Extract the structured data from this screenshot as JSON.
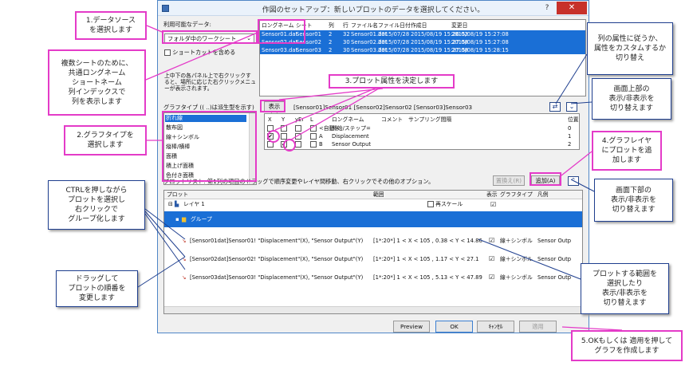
{
  "dialog": {
    "title": "作図のセットアップ：新しいプロットのデータを選択してください。",
    "help": "?",
    "close": "✕"
  },
  "left_panel": {
    "available_data_label": "利用可能なデータ:",
    "available_data_value": "フォルダ中のワークシート",
    "shortcut_label": "ショートカットを含める",
    "hint_text": "上中下の各パネル上で右クリックすると、場所に応じた右クリックメニューが表示されます。"
  },
  "top_grid": {
    "headers": [
      "ロングネーム",
      "シート",
      "列",
      "行",
      "ファイル名",
      "ファイル日付",
      "作成日",
      "変更日"
    ],
    "rows": [
      [
        "Sensor01.dat",
        "Sensor01",
        "2",
        "32",
        "Sensor01.dat",
        "2015/07/28",
        "2015/08/19 15:26:02",
        "2015/08/19 15:27:08"
      ],
      [
        "Sensor02.dat",
        "Sensor02",
        "2",
        "30",
        "Sensor02.dat",
        "2015/07/28",
        "2015/08/19 15:27:08",
        "2015/08/19 15:27:08"
      ],
      [
        "Sensor03.dat",
        "Sensor03",
        "2",
        "30",
        "Sensor03.dat",
        "2015/07/28",
        "2015/08/19 15:27:08",
        "2015/08/19 15:28:15"
      ]
    ]
  },
  "middle": {
    "graph_type_label": "グラフタイプ (( ..)は派生型を示す)",
    "show_button": "表示(S)",
    "selected_sheets": "[Sensor01]Sensor01 [Sensor02]Sensor02 [Sensor03]Sensor03",
    "graph_types": [
      "折れ線",
      "散布図",
      "線＋シンボル",
      "縦棒/横棒",
      "面積",
      "積上げ面積",
      "色付き面積"
    ],
    "col_headers": [
      "X",
      "Y",
      "yEr",
      "L",
      "ロングネーム",
      "コメント",
      "サンプリング間隔",
      "位置"
    ],
    "col_rows": [
      [
        "",
        "<自動>",
        "開始/ステップ=",
        "0"
      ],
      [
        "",
        "A",
        "Displacement",
        "1"
      ],
      [
        "",
        "B",
        "Sensor Output",
        "2"
      ]
    ]
  },
  "plot_list": {
    "title": "プロットリスト: 第1列の項目のドラッグで順序変更やレイヤ間移動、右クリックでその他のオプション。",
    "replace_button": "置換え(R)",
    "add_button": "追加(A)",
    "headers": [
      "プロット",
      "範囲",
      "表示",
      "グラフタイプ",
      "凡例"
    ],
    "layer_label": "レイヤ 1",
    "rescale_label": "再スケール",
    "group_label": "グループ",
    "rows": [
      {
        "plot": "[Sensor01dat]Sensor01! \"Displacement\"(X), \"Sensor Output\"(Y)",
        "range": "[1*:20*]  1 < X < 105 , 0.38 < Y < 14.86",
        "type": "線＋シンボル",
        "legend": "Sensor Outp"
      },
      {
        "plot": "[Sensor02dat]Sensor02! \"Displacement\"(X), \"Sensor Output\"(Y)",
        "range": "[1*:20*]  1 < X < 105 , 1.17 < Y < 27.1",
        "type": "線＋シンボル",
        "legend": "Sensor Outp"
      },
      {
        "plot": "[Sensor03dat]Sensor03! \"Displacement\"(X), \"Sensor Output\"(Y)",
        "range": "[1*:20*]  1 < X < 105 , 5.13 < Y < 47.89",
        "type": "線＋シンボル",
        "legend": "Sensor Outp"
      }
    ]
  },
  "footer": {
    "preview": "Preview",
    "ok": "OK",
    "cancel": "ｷｬﾝｾﾙ",
    "apply": "適用"
  },
  "callouts": {
    "c1": "1.データソース\nを選択します",
    "c_multi": "複数シートのために、\n共通ロングネーム\nショートネーム\n列インデックスで\n列を表示します",
    "c2": "2.グラフタイプを\n選択します",
    "c3": "3.プロット属性を決定します",
    "c_ctrl": "CTRLを押しながら\nプロットを選択し\n右クリックで\nグループ化します",
    "c_drag": "ドラッグして\nプロットの順番を\n変更します",
    "c_col_attr": "列の属性に従うか、\n属性をカスタムするか\n切り替え",
    "c_top_toggle": "画面上部の\n表示/非表示を\n切り替えます",
    "c4": "4.グラフレイヤ\nにプロットを追\n加します",
    "c_bottom_toggle": "画面下部の\n表示/非表示を\n切り替えます",
    "c_range": "プロットする範囲を\n選択したり\n表示/非表示を\n切り替えます",
    "c5": "5.OKもしくは 適用を押して\nグラフを作成します"
  },
  "colors": {
    "selection": "#1a6fd6",
    "callout_border": "#e43bc8",
    "callout_blue_border": "#1f3f8f"
  }
}
